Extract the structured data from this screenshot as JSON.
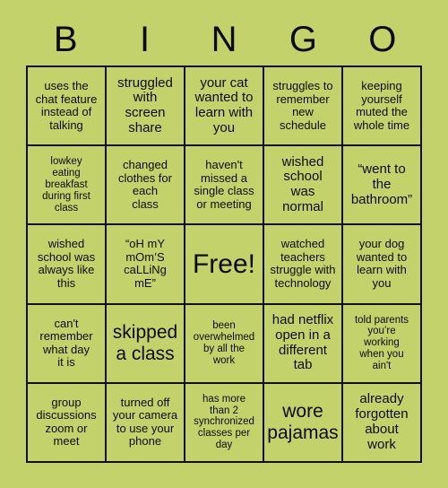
{
  "header": {
    "letters": [
      "B",
      "I",
      "N",
      "G",
      "O"
    ]
  },
  "grid": {
    "rows": [
      [
        {
          "text": "uses the\nchat feature\ninstead of\ntalking",
          "size": "s"
        },
        {
          "text": "struggled\nwith\nscreen\nshare",
          "size": "m"
        },
        {
          "text": "your cat\nwanted to\nlearn with\nyou",
          "size": "m"
        },
        {
          "text": "struggles to\nremember\nnew\nschedule",
          "size": "s"
        },
        {
          "text": "keeping\nyourself\nmuted the\nwhole time",
          "size": "s"
        }
      ],
      [
        {
          "text": "lowkey\neating\nbreakfast\nduring first\nclass",
          "size": "xs"
        },
        {
          "text": "changed\nclothes for\neach\nclass",
          "size": "s"
        },
        {
          "text": "haven't\nmissed a\nsingle class\nor meeting",
          "size": "s"
        },
        {
          "text": "wished\nschool\nwas\nnormal",
          "size": "m"
        },
        {
          "text": "“went to\nthe\nbathroom”",
          "size": "m"
        }
      ],
      [
        {
          "text": "wished\nschool was\nalways like\nthis",
          "size": "s"
        },
        {
          "text": "“oH mY\nmOm’S\ncaLLiNg\nmE”",
          "size": "s"
        },
        {
          "text": "Free!",
          "size": "xl"
        },
        {
          "text": "watched\nteachers\nstruggle with\ntechnology",
          "size": "s"
        },
        {
          "text": "your dog\nwanted to\nlearn with\nyou",
          "size": "s"
        }
      ],
      [
        {
          "text": "can't\nremember\nwhat day\nit is",
          "size": "s"
        },
        {
          "text": "skipped\na class",
          "size": "l"
        },
        {
          "text": "been\noverwhelmed\nby all the\nwork",
          "size": "xs"
        },
        {
          "text": "had netflix\nopen in a\ndifferent\ntab",
          "size": "m"
        },
        {
          "text": "told parents\nyou’re\nworking\nwhen you\nain't",
          "size": "xs"
        }
      ],
      [
        {
          "text": "group\ndiscussions\nzoom or\nmeet",
          "size": "s"
        },
        {
          "text": "turned off\nyour camera\nto use your\nphone",
          "size": "s"
        },
        {
          "text": "has more\nthan 2\nsynchronized\nclasses per\nday",
          "size": "xs"
        },
        {
          "text": "wore\npajamas",
          "size": "l"
        },
        {
          "text": "already\nforgotten\nabout\nwork",
          "size": "m"
        }
      ]
    ]
  },
  "colors": {
    "background": "#c3d26b",
    "grid_line": "#111111",
    "text": "#0c0c0c"
  }
}
